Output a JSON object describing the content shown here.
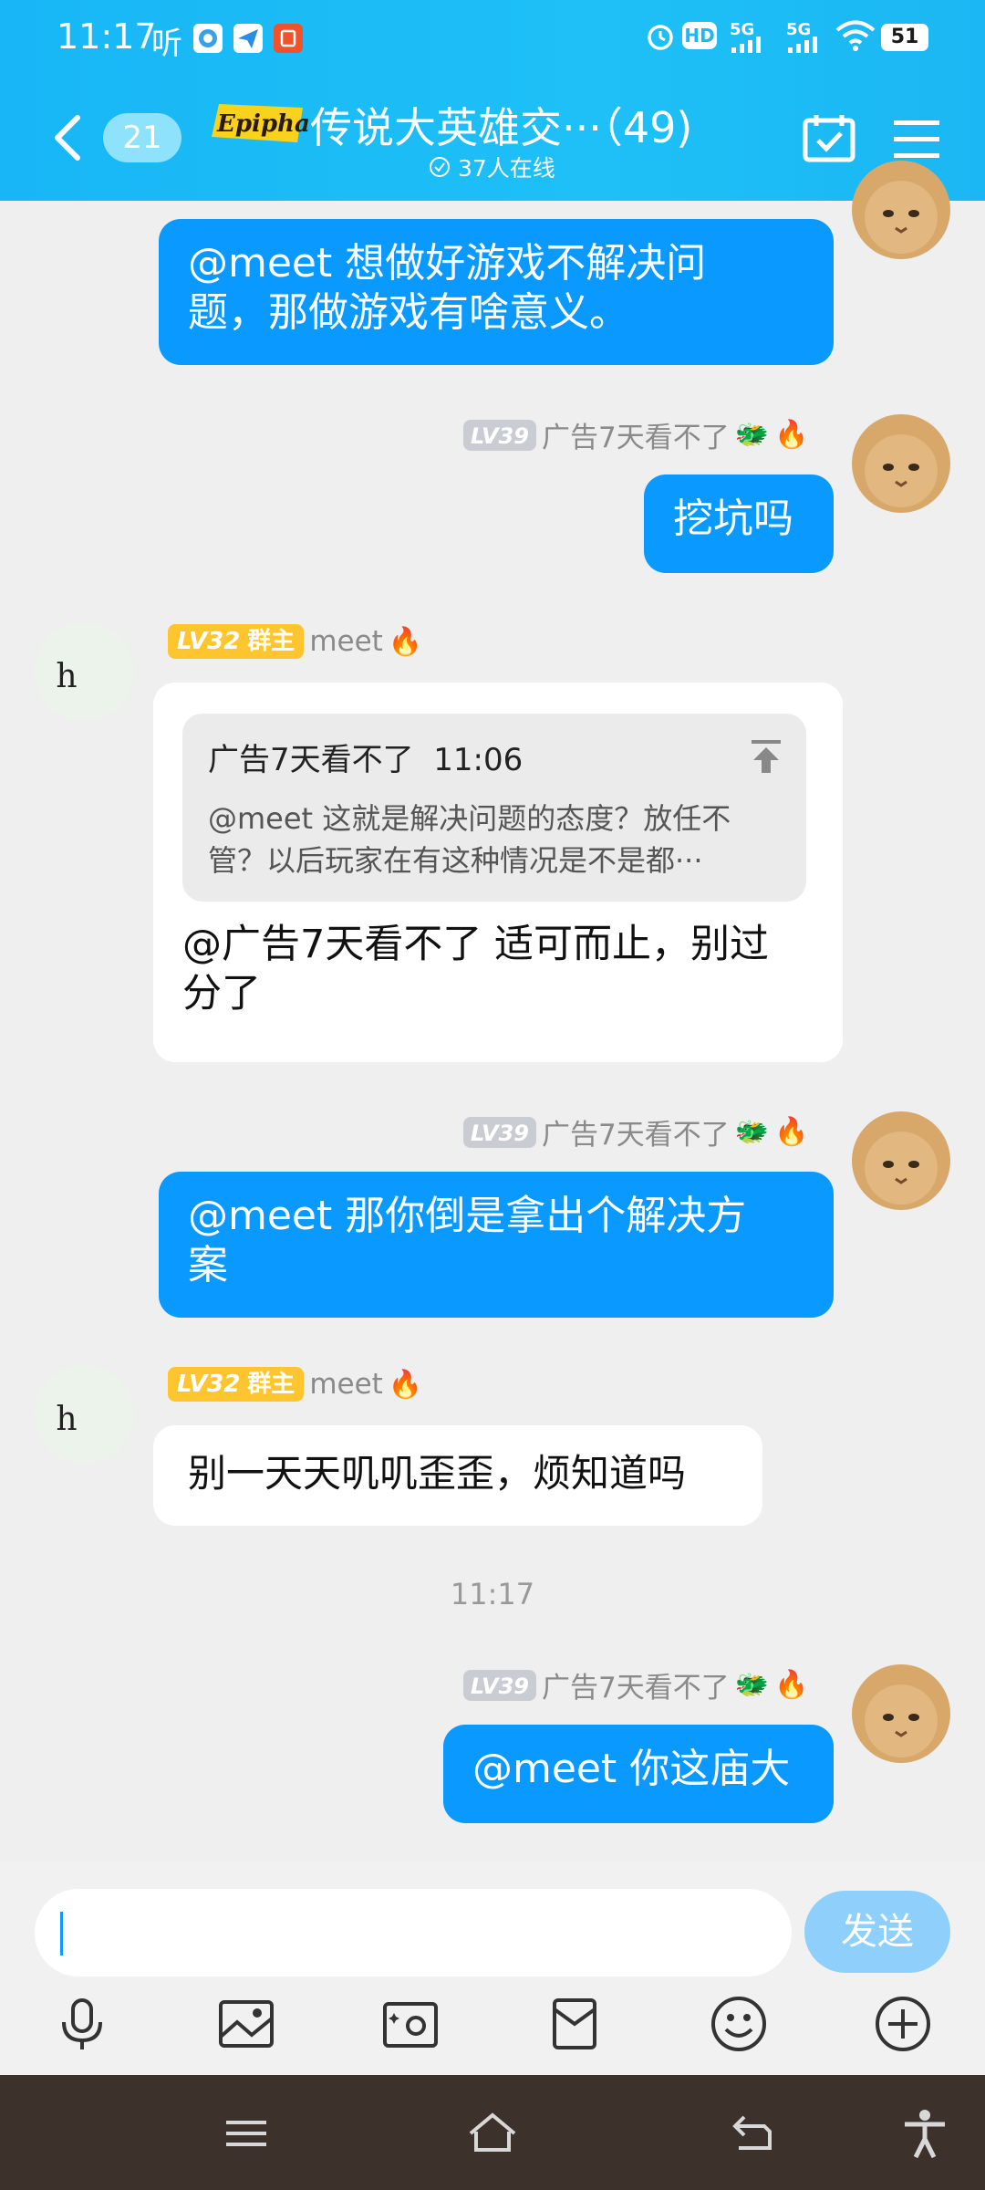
{
  "status_bar": {
    "time": "11:17",
    "app_label": "听",
    "signal_1": "5G",
    "signal_2": "5G",
    "hd_label": "HD",
    "battery": "51"
  },
  "header": {
    "back_count": "21",
    "logo_text": "Epiphany",
    "title": "传说大英雄交···（49)",
    "online": "37人在线"
  },
  "messages": [
    {
      "side": "right",
      "text": "@meet  想做好游戏不解决问题，那做游戏有啥意义。",
      "line1": "@meet  想做好游戏不解决问",
      "line2": "题，那做游戏有啥意义。"
    },
    {
      "side": "right",
      "level": "LV39",
      "sender": "广告7天看不了",
      "text": "挖坑吗"
    },
    {
      "side": "left",
      "level": "LV32",
      "role": "群主",
      "sender": "meet",
      "avatar_letter": "h",
      "quote": {
        "author": "广告7天看不了",
        "time": "11:06",
        "line1": "@meet  这就是解决问题的态度？放任不",
        "line2": "管？以后玩家在有这种情况是不是都···"
      },
      "line1": "@广告7天看不了  适可而止，别过",
      "line2": "分了"
    },
    {
      "side": "right",
      "level": "LV39",
      "sender": "广告7天看不了",
      "line1": "@meet  那你倒是拿出个解决方",
      "line2": "案"
    },
    {
      "side": "left",
      "level": "LV32",
      "role": "群主",
      "sender": "meet",
      "avatar_letter": "h",
      "text": "别一天天叽叽歪歪，烦知道吗"
    },
    {
      "side": "right",
      "level": "LV39",
      "sender": "广告7天看不了",
      "text": "@meet  你这庙大"
    }
  ],
  "timestamp": "11:17",
  "input": {
    "placeholder": "",
    "send_label": "发送"
  },
  "toolbar": [
    "mic-icon",
    "image-icon",
    "camera-icon",
    "red-packet-icon",
    "emoji-icon",
    "plus-icon"
  ],
  "colors": {
    "header": "#1bb8f5",
    "bubble_blue": "#0a99ff",
    "background": "#efefef",
    "send": "#8ed0fb"
  }
}
